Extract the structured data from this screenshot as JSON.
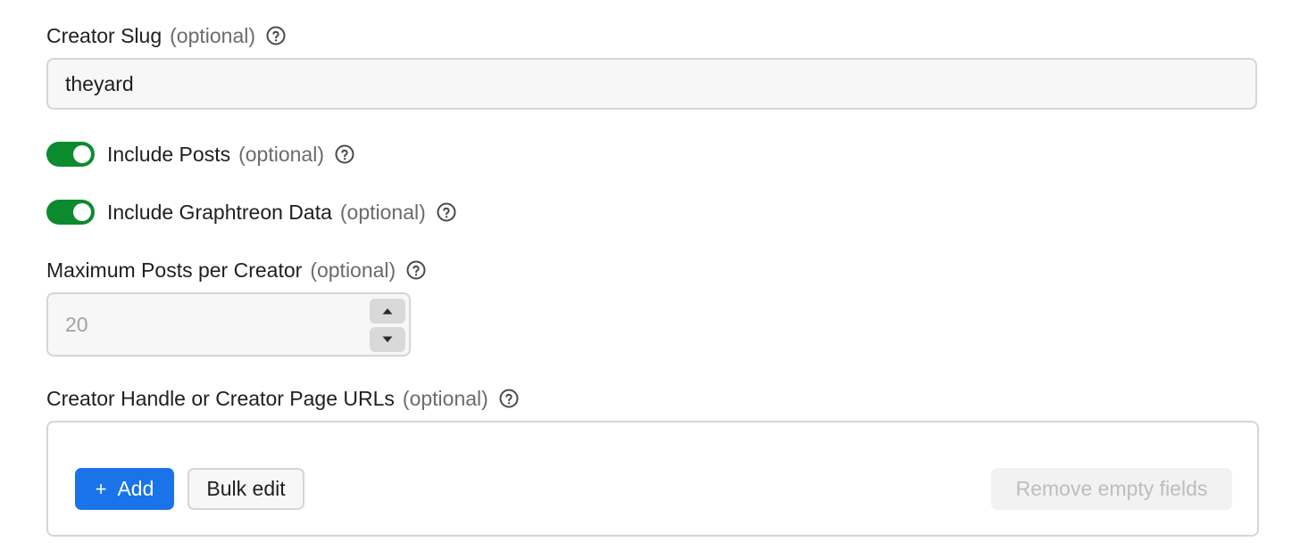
{
  "creator_slug": {
    "label": "Creator Slug",
    "optional": "(optional)",
    "value": "theyard"
  },
  "include_posts": {
    "label": "Include Posts",
    "optional": "(optional)",
    "enabled": true
  },
  "include_graphtreon": {
    "label": "Include Graphtreon Data",
    "optional": "(optional)",
    "enabled": true
  },
  "max_posts": {
    "label": "Maximum Posts per Creator",
    "optional": "(optional)",
    "placeholder": "20"
  },
  "creator_urls": {
    "label": "Creator Handle or Creator Page URLs",
    "optional": "(optional)",
    "add_label": "Add",
    "bulk_edit_label": "Bulk edit",
    "remove_empty_label": "Remove empty fields"
  },
  "icons": {
    "help": "help-circle-icon",
    "plus": "plus-icon",
    "stepper_up": "caret-up-icon",
    "stepper_down": "caret-down-icon"
  },
  "colors": {
    "toggle_on": "#0c8a2e",
    "primary_button": "#1a73e8",
    "input_border": "#d6d6d6",
    "input_background": "#f7f7f7"
  }
}
